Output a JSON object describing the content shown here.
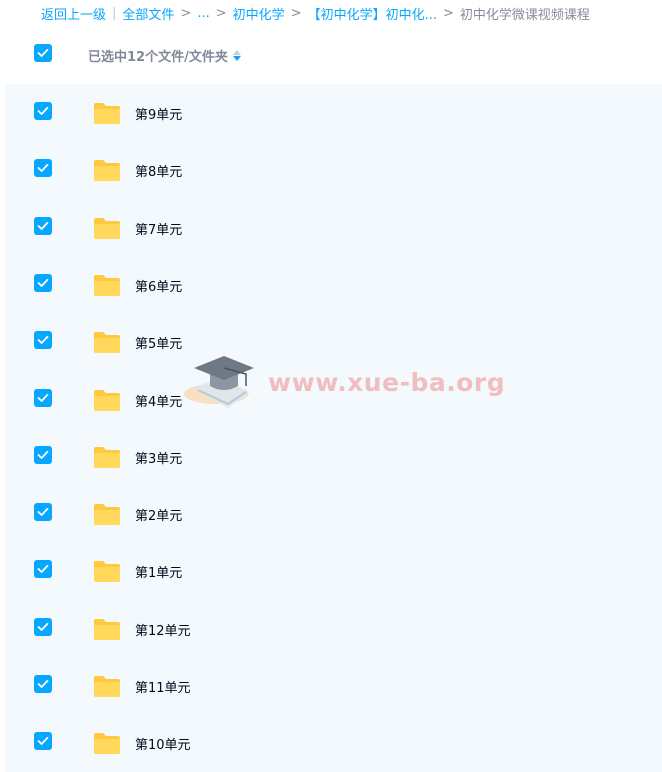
{
  "breadcrumb": {
    "back": "返回上一级",
    "all_files": "全部文件",
    "ellipsis": "...",
    "level1": "初中化学",
    "level2": "【初中化学】初中化...",
    "current": "初中化学微课视频课程",
    "sep_bar": "|",
    "sep_arrow": ">"
  },
  "header": {
    "select_all_checked": true,
    "selected_label": "已选中12个文件/文件夹"
  },
  "files": [
    {
      "name": "第9单元",
      "checked": true
    },
    {
      "name": "第8单元",
      "checked": true
    },
    {
      "name": "第7单元",
      "checked": true
    },
    {
      "name": "第6单元",
      "checked": true
    },
    {
      "name": "第5单元",
      "checked": true
    },
    {
      "name": "第4单元",
      "checked": true
    },
    {
      "name": "第3单元",
      "checked": true
    },
    {
      "name": "第2单元",
      "checked": true
    },
    {
      "name": "第1单元",
      "checked": true
    },
    {
      "name": "第12单元",
      "checked": true
    },
    {
      "name": "第11单元",
      "checked": true
    },
    {
      "name": "第10单元",
      "checked": true
    }
  ],
  "watermark": {
    "text": "www.xue-ba.org"
  },
  "colors": {
    "accent": "#06a7ff",
    "folder": "#ffd04a",
    "list_bg": "#f3f9fd"
  },
  "icons": {
    "checkbox": "check-icon",
    "folder": "folder-icon",
    "sort": "sort-icon",
    "watermark": "graduation-cap-icon"
  }
}
